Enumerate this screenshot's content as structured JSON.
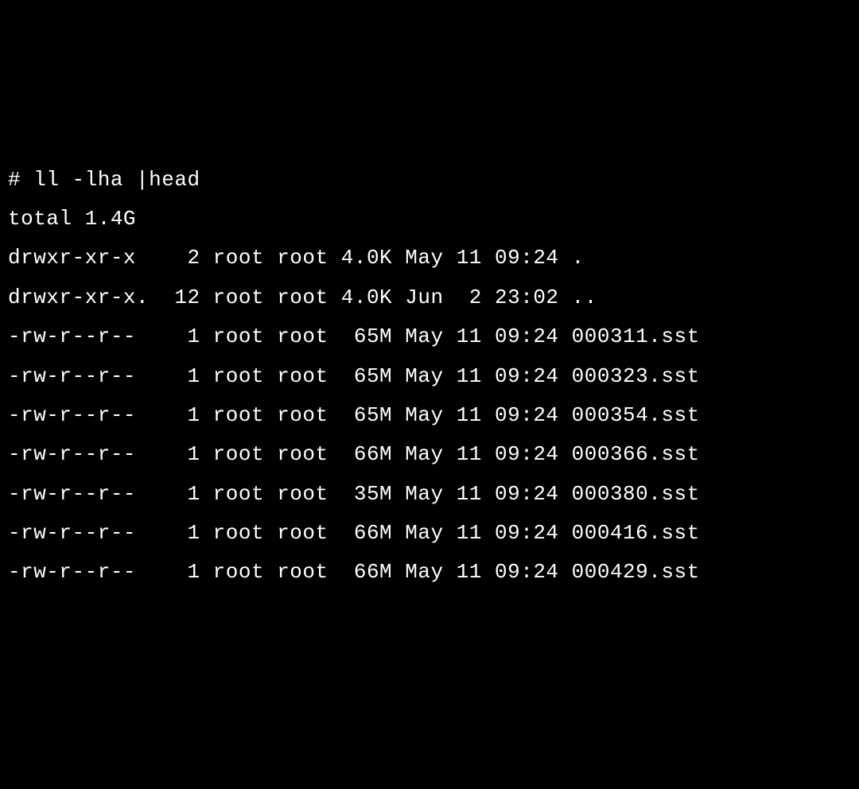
{
  "terminal": {
    "prompt": "# ",
    "command": "ll -lha |head",
    "total_line": "total 1.4G",
    "entries": [
      {
        "perms": "drwxr-xr-x ",
        "links": "  2",
        "owner": "root",
        "group": "root",
        "size": "4.0K",
        "month": "May",
        "day": "11",
        "time": "09:24",
        "name": "."
      },
      {
        "perms": "drwxr-xr-x.",
        "links": " 12",
        "owner": "root",
        "group": "root",
        "size": "4.0K",
        "month": "Jun",
        "day": " 2",
        "time": "23:02",
        "name": ".."
      },
      {
        "perms": "-rw-r--r-- ",
        "links": "  1",
        "owner": "root",
        "group": "root",
        "size": " 65M",
        "month": "May",
        "day": "11",
        "time": "09:24",
        "name": "000311.sst"
      },
      {
        "perms": "-rw-r--r-- ",
        "links": "  1",
        "owner": "root",
        "group": "root",
        "size": " 65M",
        "month": "May",
        "day": "11",
        "time": "09:24",
        "name": "000323.sst"
      },
      {
        "perms": "-rw-r--r-- ",
        "links": "  1",
        "owner": "root",
        "group": "root",
        "size": " 65M",
        "month": "May",
        "day": "11",
        "time": "09:24",
        "name": "000354.sst"
      },
      {
        "perms": "-rw-r--r-- ",
        "links": "  1",
        "owner": "root",
        "group": "root",
        "size": " 66M",
        "month": "May",
        "day": "11",
        "time": "09:24",
        "name": "000366.sst"
      },
      {
        "perms": "-rw-r--r-- ",
        "links": "  1",
        "owner": "root",
        "group": "root",
        "size": " 35M",
        "month": "May",
        "day": "11",
        "time": "09:24",
        "name": "000380.sst"
      },
      {
        "perms": "-rw-r--r-- ",
        "links": "  1",
        "owner": "root",
        "group": "root",
        "size": " 66M",
        "month": "May",
        "day": "11",
        "time": "09:24",
        "name": "000416.sst"
      },
      {
        "perms": "-rw-r--r-- ",
        "links": "  1",
        "owner": "root",
        "group": "root",
        "size": " 66M",
        "month": "May",
        "day": "11",
        "time": "09:24",
        "name": "000429.sst"
      }
    ]
  }
}
